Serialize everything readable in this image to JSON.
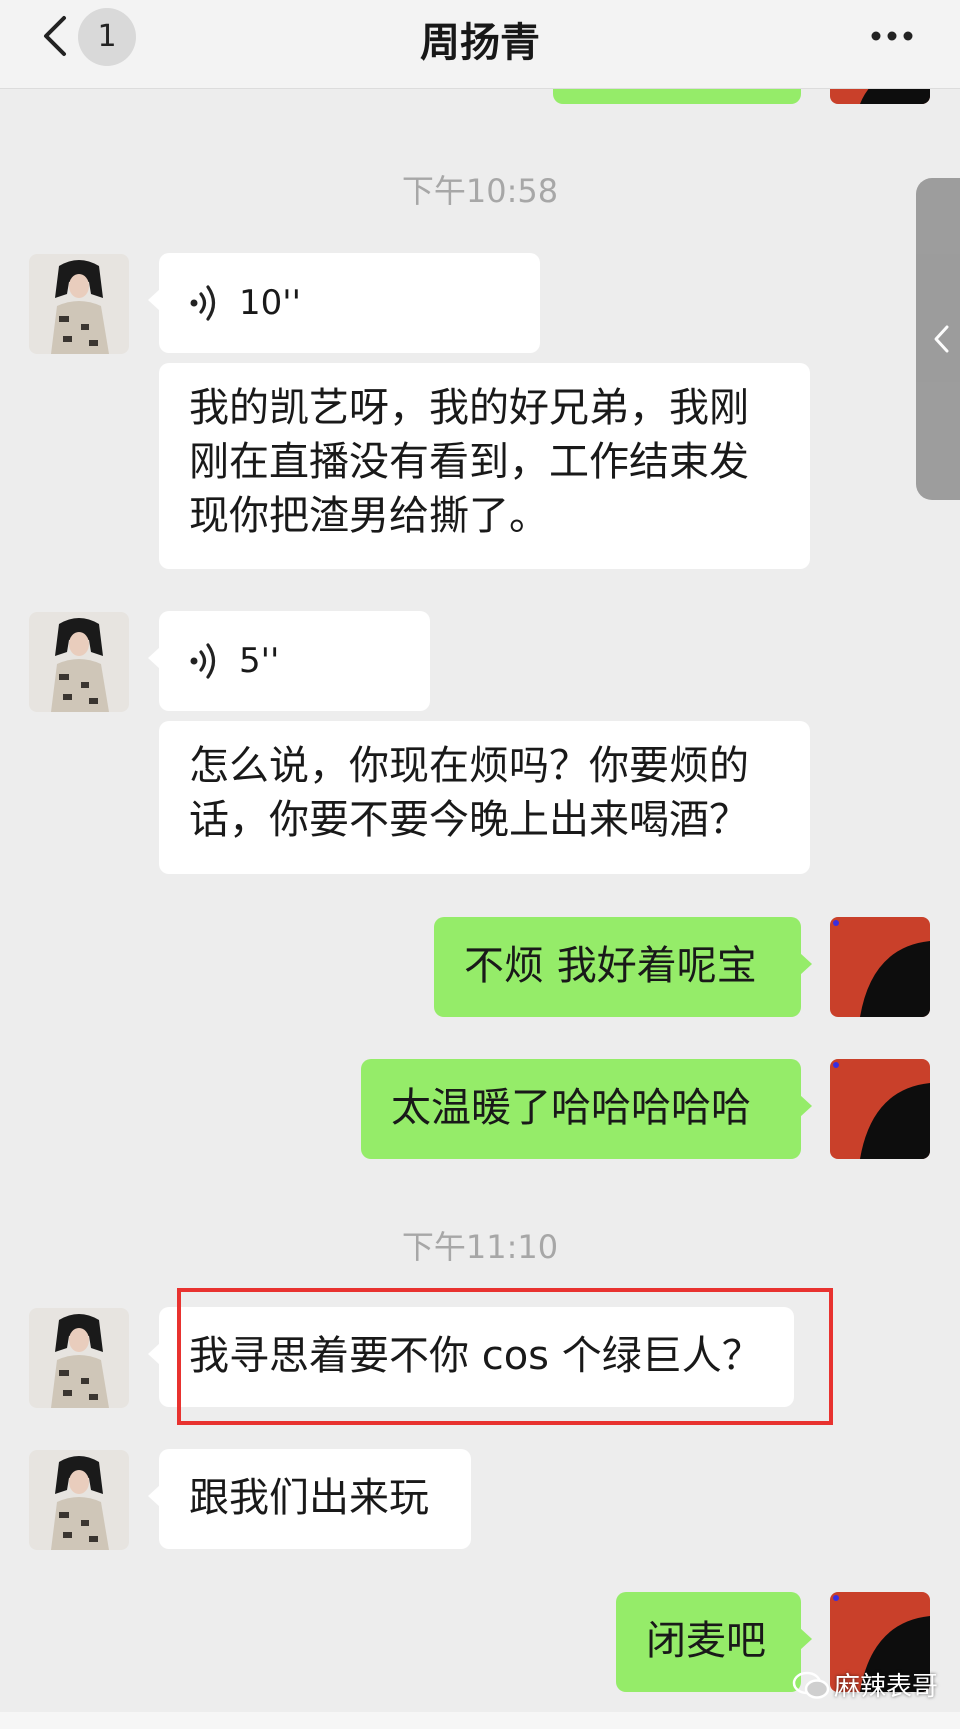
{
  "header": {
    "title": "周扬青",
    "unread_count": "1"
  },
  "colors": {
    "incoming_bubble": "#ffffff",
    "outgoing_bubble": "#95ec69",
    "background": "#ededed",
    "highlight": "#e8322f"
  },
  "icons": {
    "back": "chevron-left-icon",
    "more": "more-dots-icon",
    "voice": "voice-wave-icon",
    "side": "chevron-left-icon"
  },
  "messages": {
    "t1": "下午10:58",
    "m1_voice": "10''",
    "m2": "我的凯艺呀，我的好兄弟，我刚刚在直播没有看到，工作结束发现你把渣男给撕了。",
    "m3_voice": "5''",
    "m4": "怎么说，你现在烦吗？你要烦的话，你要不要今晚上出来喝酒？",
    "m5": "不烦 我好着呢宝",
    "m6": "太温暖了哈哈哈哈哈",
    "t2": "下午11:10",
    "m7": "我寻思着要不你 cos 个绿巨人？",
    "m8": "跟我们出来玩",
    "m9": "闭麦吧"
  },
  "watermark": "麻辣表哥"
}
